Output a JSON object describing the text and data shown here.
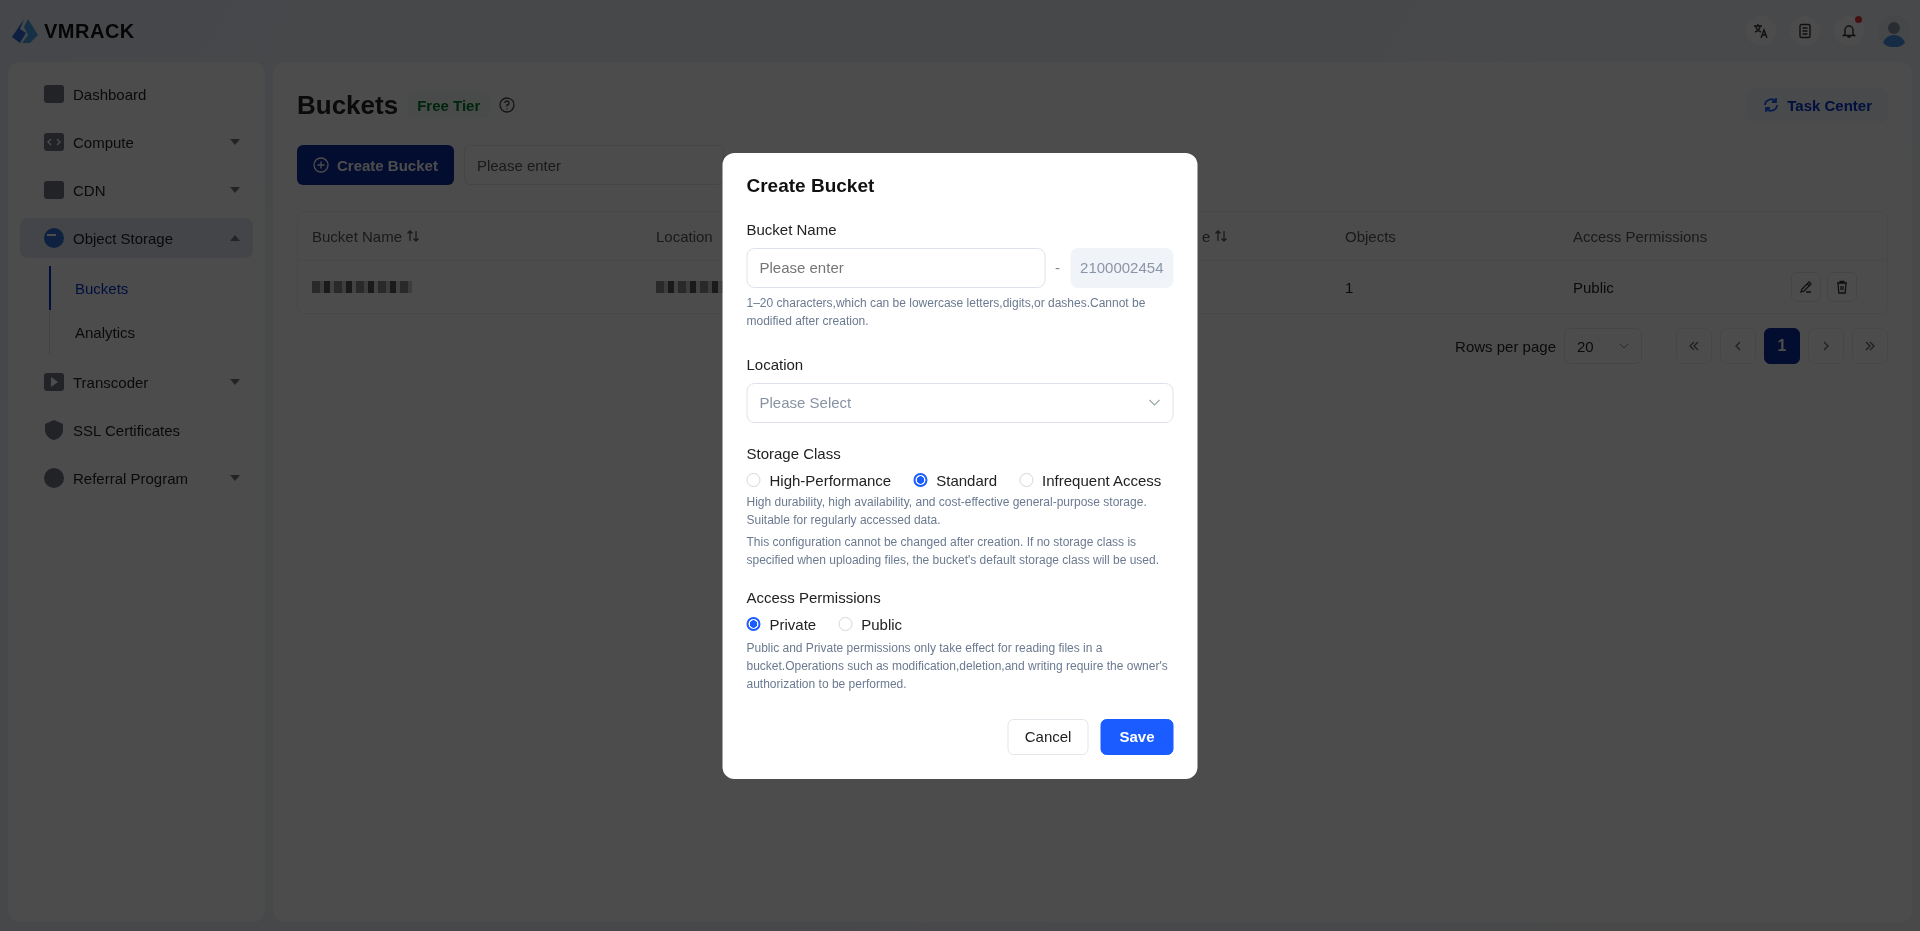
{
  "header": {
    "logo": "VMRACK",
    "notifications_unread": true
  },
  "sidebar": {
    "items": [
      {
        "label": "Dashboard",
        "kind": "link"
      },
      {
        "label": "Compute",
        "kind": "group",
        "expanded": false
      },
      {
        "label": "CDN",
        "kind": "group",
        "expanded": false
      },
      {
        "label": "Object Storage",
        "kind": "group",
        "expanded": true,
        "children": [
          {
            "label": "Buckets",
            "selected": true
          },
          {
            "label": "Analytics",
            "selected": false
          }
        ]
      },
      {
        "label": "Transcoder",
        "kind": "group",
        "expanded": false
      },
      {
        "label": "SSL Certificates",
        "kind": "link"
      },
      {
        "label": "Referral Program",
        "kind": "group",
        "expanded": false
      }
    ]
  },
  "page": {
    "title": "Buckets",
    "badge": "Free Tier",
    "task_center": "Task Center"
  },
  "toolbar": {
    "create_button": "Create Bucket",
    "search": {
      "placeholder": "Please enter"
    }
  },
  "table": {
    "columns": [
      {
        "label": "Bucket Name",
        "sortable": true
      },
      {
        "label": "Location",
        "sortable": false
      },
      {
        "label": "e",
        "sortable": true
      },
      {
        "label": "Objects",
        "sortable": false
      },
      {
        "label": "Access Permissions",
        "sortable": false
      }
    ],
    "rows": [
      {
        "cells": [
          {
            "kind": "redacted"
          },
          {
            "kind": "redacted"
          },
          {
            "kind": "empty"
          },
          {
            "kind": "text",
            "text": "1"
          },
          {
            "kind": "text",
            "text": "Public"
          }
        ]
      }
    ]
  },
  "pagination": {
    "rows_per_page_label": "Rows per page",
    "rows_per_page": "20",
    "pages": [
      {
        "label": "1",
        "selected": true
      }
    ]
  },
  "dialog": {
    "title": "Create Bucket",
    "bucket_name": {
      "label": "Bucket Name",
      "placeholder": "Please enter",
      "separator": "-",
      "suffix": "2100002454",
      "help": "1–20 characters,which can be lowercase letters,digits,or dashes.Cannot be modified after creation."
    },
    "location": {
      "label": "Location",
      "placeholder": "Please Select"
    },
    "storage_class": {
      "label": "Storage Class",
      "options": [
        {
          "label": "High-Performance",
          "selected": false
        },
        {
          "label": "Standard",
          "selected": true
        },
        {
          "label": "Infrequent Access",
          "selected": false
        }
      ],
      "help": [
        "High durability, high availability, and cost-effective general-purpose storage. Suitable for regularly accessed data.",
        "This configuration cannot be changed after creation. If no storage class is specified when uploading files, the bucket's default storage class will be used."
      ]
    },
    "access": {
      "label": "Access Permissions",
      "options": [
        {
          "label": "Private",
          "selected": true
        },
        {
          "label": "Public",
          "selected": false
        }
      ],
      "help": "Public and Private permissions only take effect for reading files in a bucket.Operations such as modification,deletion,and writing require the owner's authorization to be performed."
    },
    "buttons": [
      {
        "label": "Cancel",
        "kind": "secondary"
      },
      {
        "label": "Save",
        "kind": "primary"
      }
    ]
  }
}
